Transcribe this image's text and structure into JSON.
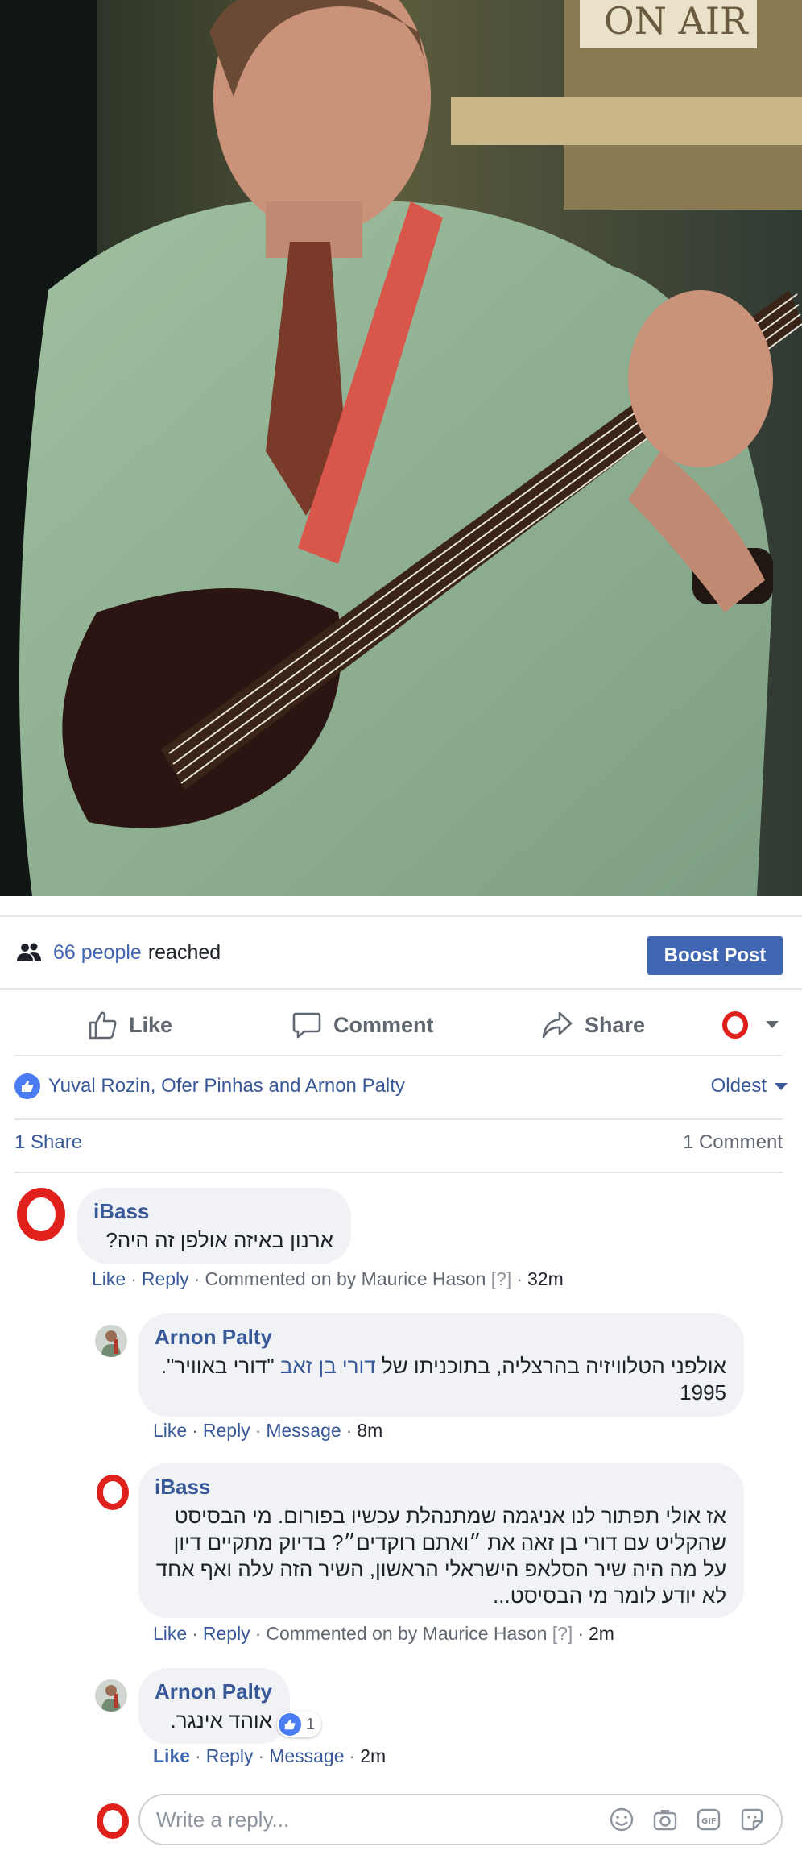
{
  "photo": {
    "sign_text": "ON AIR"
  },
  "reach": {
    "count": "66 people",
    "suffix": "reached"
  },
  "boost": {
    "label": "Boost Post"
  },
  "actions": {
    "like": "Like",
    "comment": "Comment",
    "share": "Share"
  },
  "reactions": {
    "names": "Yuval Rozin, Ofer Pinhas and Arnon Palty",
    "sort": "Oldest"
  },
  "counts": {
    "shares": "1 Share",
    "comments": "1 Comment"
  },
  "comments": [
    {
      "author": "iBass",
      "text": "ארנון באיזה אולפן זה היה?",
      "like": "Like",
      "reply": "Reply",
      "commented_on": "Commented on by Maurice Hason",
      "q": "[?]",
      "time": "32m"
    },
    {
      "author": "Arnon Palty",
      "text_pre": "אולפני הטלוויזיה בהרצליה, בתוכניתו של ",
      "text_link": "דורי בן זאב",
      "text_post": " \"דורי באוויר\". 1995",
      "like": "Like",
      "reply": "Reply",
      "message": "Message",
      "time": "8m"
    },
    {
      "author": "iBass",
      "text": "אז אולי תפתור לנו אניגמה שמתנהלת עכשיו בפורום. מי הבסיסט שהקליט עם דורי בן זאה את ״ואתם רוקדים״? בדיוק מתקיים דיון על מה היה שיר הסלאפ הישראלי הראשון, השיר הזה עלה ואף אחד לא יודע לומר מי הבסיסט...",
      "like": "Like",
      "reply": "Reply",
      "commented_on": "Commented on by Maurice Hason",
      "q": "[?]",
      "time": "2m"
    },
    {
      "author": "Arnon Palty",
      "text": "אוהד אינגר.",
      "reaction_count": "1",
      "like": "Like",
      "reply": "Reply",
      "message": "Message",
      "time": "2m"
    }
  ],
  "reply_box": {
    "placeholder": "Write a reply..."
  },
  "colors": {
    "accent": "#4267b2",
    "link": "#385898",
    "opera_red": "#e0201b"
  }
}
